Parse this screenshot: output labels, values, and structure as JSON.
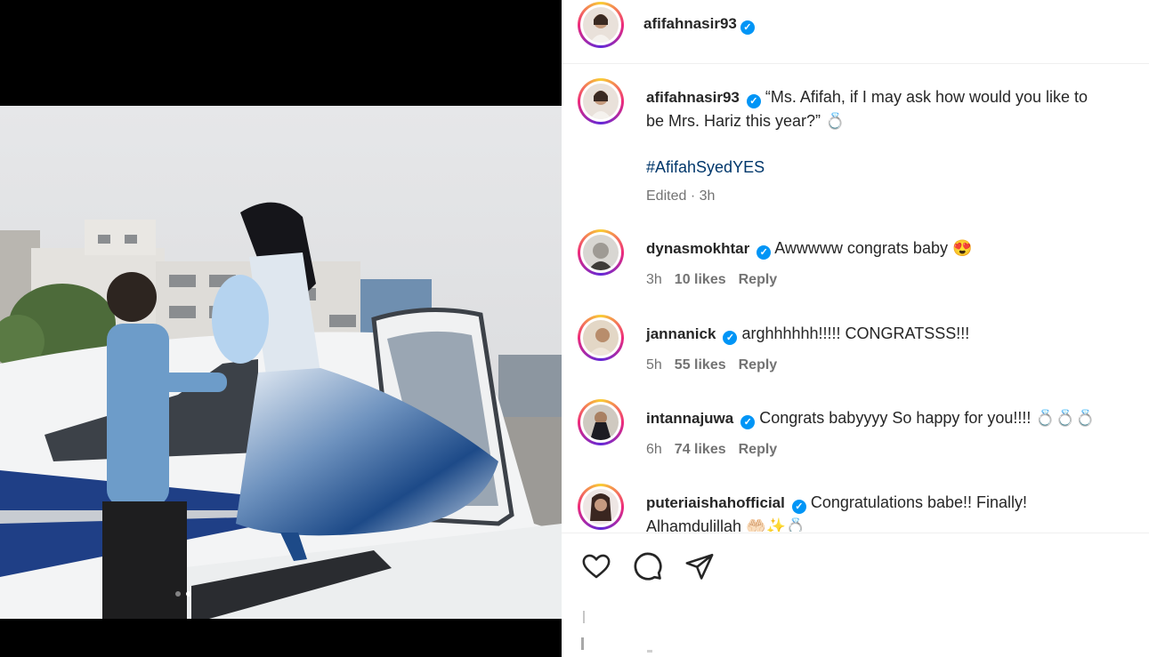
{
  "post": {
    "author": "afifahnasir93",
    "caption_line1": "“Ms. Afifah, if I may ask how would you like to",
    "caption_line2": "be Mrs. Hariz this year?” 💍",
    "hashtag": "#AfifahSyedYES",
    "edited": "Edited · 3h",
    "carousel": {
      "count": 2,
      "active_index": 1
    }
  },
  "comments": [
    {
      "user": "dynasmokhtar",
      "text": "Awwwww congrats baby 😍",
      "time": "3h",
      "likes": "10 likes",
      "reply": "Reply"
    },
    {
      "user": "jannanick",
      "text": "arghhhhhh!!!!! CONGRATSSS!!!",
      "time": "5h",
      "likes": "55 likes",
      "reply": "Reply"
    },
    {
      "user": "intannajuwa",
      "text": "Congrats babyyyy So happy for you!!!! 💍💍💍",
      "time": "6h",
      "likes": "74 likes",
      "reply": "Reply"
    },
    {
      "user": "puteriaishahofficial",
      "text_line1": "Congratulations babe!! Finally!",
      "text_line2": "Alhamdulillah 🤲🏻✨💍"
    }
  ],
  "icons": {
    "verified": "verified-badge-icon",
    "like": "heart-icon",
    "comment": "comment-bubble-icon",
    "share": "paper-plane-icon"
  },
  "colors": {
    "verified": "#0095f6",
    "text": "#262626",
    "secondary": "#737373",
    "hashtag": "#00376b"
  }
}
